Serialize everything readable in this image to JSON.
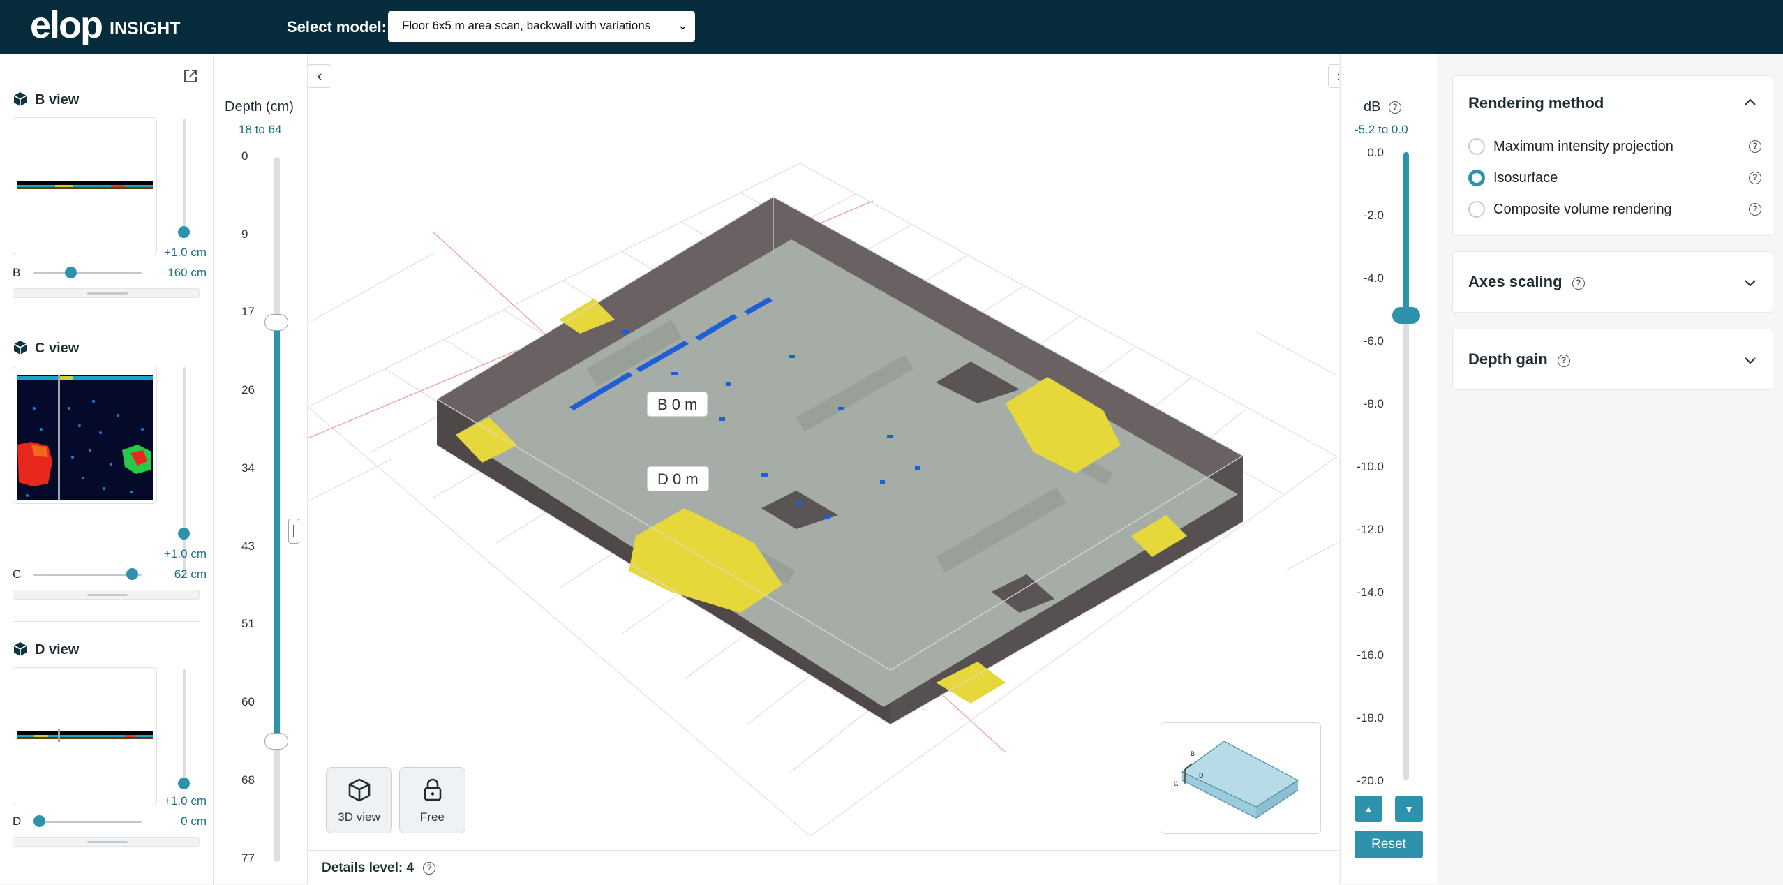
{
  "header": {
    "logo": "elop",
    "app_name": "INSIGHT",
    "model_label": "Select model:",
    "model_value": "Floor 6x5 m area scan, backwall with variations"
  },
  "views": {
    "b": {
      "title": "B view",
      "offset": "+1.0 cm",
      "letter": "B",
      "value": "160 cm"
    },
    "c": {
      "title": "C view",
      "offset": "+1.0 cm",
      "letter": "C",
      "value": "62 cm"
    },
    "d": {
      "title": "D view",
      "offset": "+1.0 cm",
      "letter": "D",
      "value": "0 cm"
    }
  },
  "depth": {
    "title": "Depth (cm)",
    "range": "18 to 64",
    "ticks": [
      "0",
      "9",
      "17",
      "26",
      "34",
      "43",
      "51",
      "60",
      "68",
      "77"
    ]
  },
  "viewport": {
    "axis_b": "B 0 m",
    "axis_d": "D 0 m",
    "view_button": "3D view",
    "free_button": "Free",
    "mini_labels": {
      "b": "B",
      "c": "C",
      "d": "D"
    }
  },
  "details": {
    "label": "Details level: 4"
  },
  "db": {
    "title": "dB",
    "range": "-5.2 to 0.0",
    "ticks": [
      "0.0",
      "-2.0",
      "-4.0",
      "-6.0",
      "-8.0",
      "-10.0",
      "-12.0",
      "-14.0",
      "-16.0",
      "-18.0",
      "-20.0"
    ],
    "reset": "Reset"
  },
  "right_panel": {
    "rendering": {
      "title": "Rendering method",
      "options": [
        "Maximum intensity projection",
        "Isosurface",
        "Composite volume rendering"
      ],
      "selected": "Isosurface"
    },
    "axes_scaling": {
      "title": "Axes scaling"
    },
    "depth_gain": {
      "title": "Depth gain"
    }
  },
  "colors": {
    "header_bg": "#062c3b",
    "accent": "#2f92ad",
    "accent_text": "#1d6f86",
    "slab": "#5b5454",
    "surface": "#a6aca6",
    "highlight_yellow": "#e6d83a",
    "defect_blue": "#1f5fd6"
  }
}
